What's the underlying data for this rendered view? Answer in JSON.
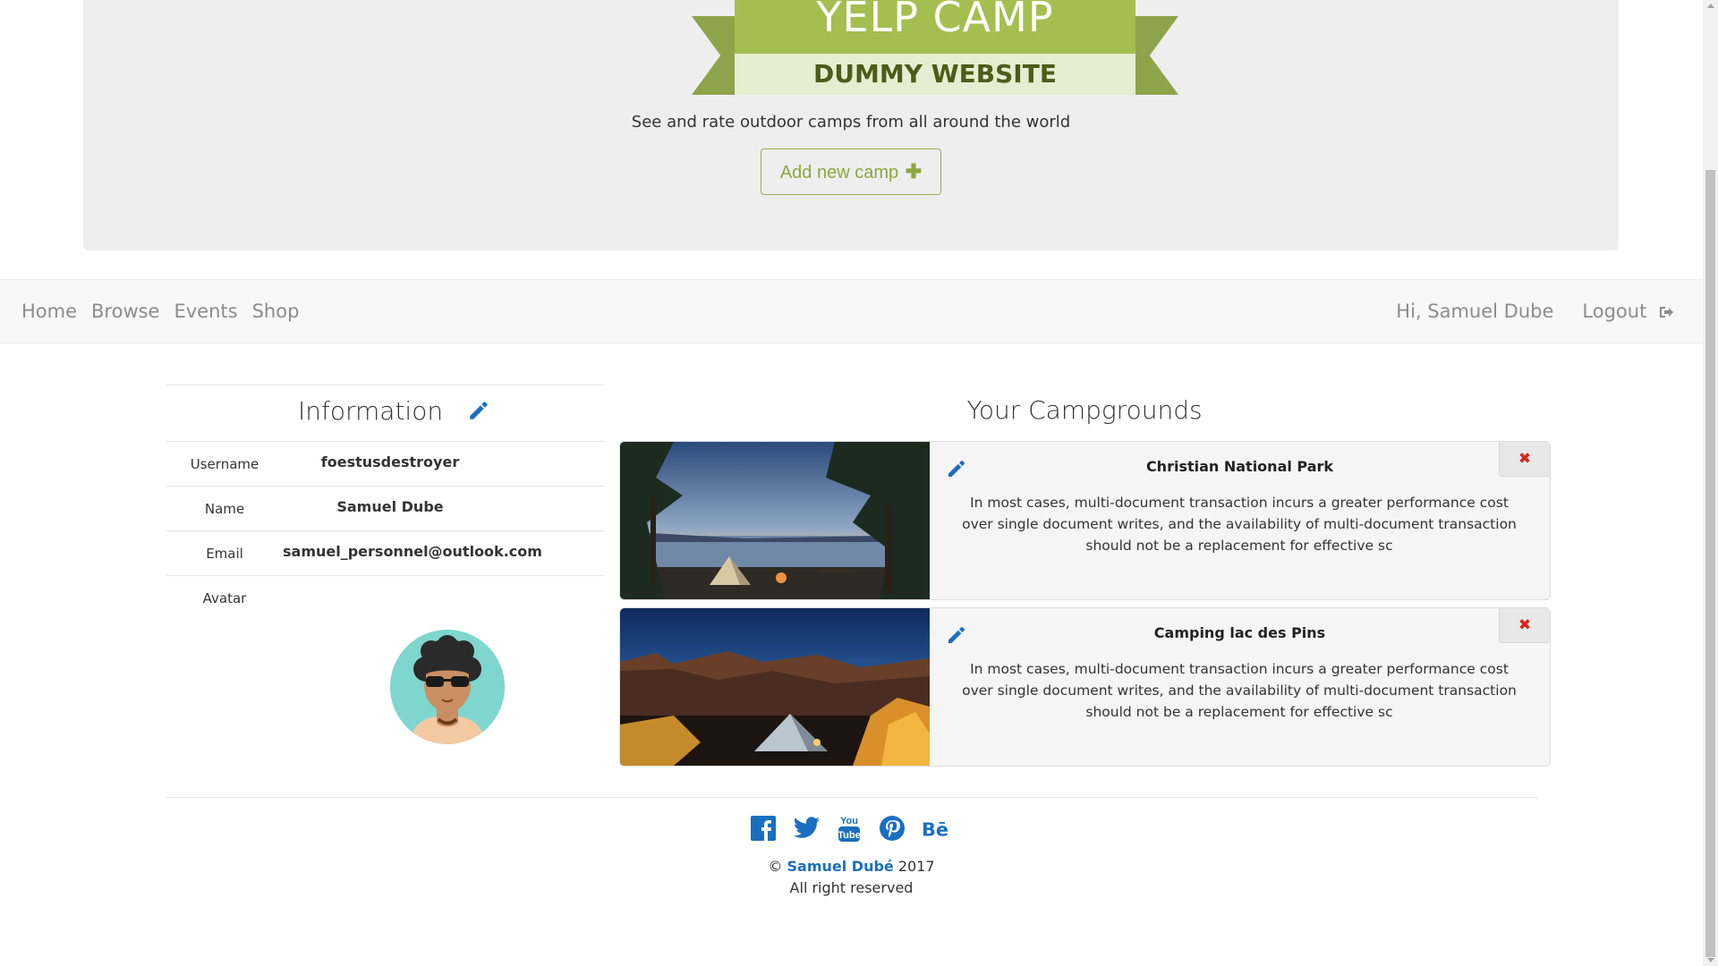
{
  "colors": {
    "accent_green": "#a5be4f",
    "link_blue": "#1a6fc0",
    "delete_red": "#d9241e",
    "nav_text": "#8c8c8c"
  },
  "header": {
    "title": "YELP CAMP",
    "subtitle": "DUMMY WEBSITE",
    "tagline": "See and rate outdoor camps from all around the world",
    "add_camp_label": "Add new camp",
    "add_camp_icon": "plus-icon"
  },
  "nav": {
    "items": [
      {
        "label": "Home"
      },
      {
        "label": "Browse"
      },
      {
        "label": "Events"
      },
      {
        "label": "Shop"
      }
    ],
    "greeting": "Hi, Samuel Dube",
    "logout_label": "Logout",
    "logout_icon": "sign-out-icon"
  },
  "info": {
    "title": "Information",
    "edit_icon": "pencil-icon",
    "rows": [
      {
        "label": "Username",
        "value": "foestusdestroyer"
      },
      {
        "label": "Name",
        "value": "Samuel Dube"
      },
      {
        "label": "Email",
        "value": "samuel_personnel@outlook.com"
      }
    ],
    "avatar_label": "Avatar"
  },
  "campgrounds": {
    "title": "Your Campgrounds",
    "items": [
      {
        "name": "Christian National Park",
        "description": "In most cases, multi-document transaction incurs a greater performance cost over single document writes, and the availability of multi-document transaction should not be a replacement for effective sc"
      },
      {
        "name": "Camping lac des Pins",
        "description": "In most cases, multi-document transaction incurs a greater performance cost over single document writes, and the availability of multi-document transaction should not be a replacement for effective sc"
      }
    ],
    "delete_glyph": "✖"
  },
  "footer": {
    "social_icons": [
      "facebook-icon",
      "twitter-icon",
      "youtube-icon",
      "pinterest-icon",
      "behance-icon"
    ],
    "copyright_symbol": "©",
    "author": "Samuel Dubé",
    "year": "2017",
    "rights": "All right reserved"
  }
}
